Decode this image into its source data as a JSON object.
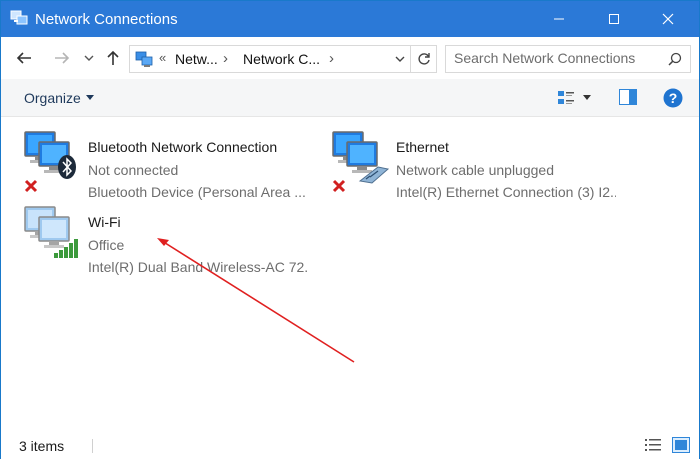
{
  "window": {
    "title": "Network Connections",
    "icon": "network-connections-icon"
  },
  "titlebar": {
    "minimize_icon": "minimize-icon",
    "maximize_icon": "maximize-icon",
    "close_icon": "close-icon"
  },
  "nav": {
    "back_icon": "arrow-left-icon",
    "forward_icon": "arrow-right-icon",
    "recent_icon": "chevron-down-icon",
    "up_icon": "arrow-up-icon",
    "refresh_icon": "refresh-icon"
  },
  "address": {
    "overflow": "«",
    "crumbs": [
      "Netw...",
      "Network C..."
    ],
    "separator": "›"
  },
  "search": {
    "placeholder": "Search Network Connections",
    "value": ""
  },
  "commandbar": {
    "organize_label": "Organize",
    "view_icon": "change-view-icon",
    "preview_pane_icon": "preview-pane-icon",
    "help_icon": "help-icon",
    "help_label": "?"
  },
  "items": [
    {
      "name": "Bluetooth Network Connection",
      "status": "Not connected",
      "device": "Bluetooth Device (Personal Area ...",
      "icon": "bluetooth-network-icon",
      "badge": "disconnected-x-icon"
    },
    {
      "name": "Ethernet",
      "status": "Network cable unplugged",
      "device": "Intel(R) Ethernet Connection (3) I2...",
      "icon": "ethernet-network-icon",
      "badge": "disconnected-x-icon"
    },
    {
      "name": "Wi-Fi",
      "status": "Office",
      "device": "Intel(R) Dual Band Wireless-AC 72...",
      "icon": "wifi-network-icon",
      "badge": "signal-bars-icon"
    }
  ],
  "statusbar": {
    "count": "3 items",
    "details_view_icon": "details-view-icon",
    "large_icons_view_icon": "large-icons-view-icon"
  },
  "colors": {
    "titlebar": "#2b79d7",
    "annotation_arrow": "#e02020",
    "disconnected": "#d12020",
    "signal": "#3c9a3c"
  }
}
